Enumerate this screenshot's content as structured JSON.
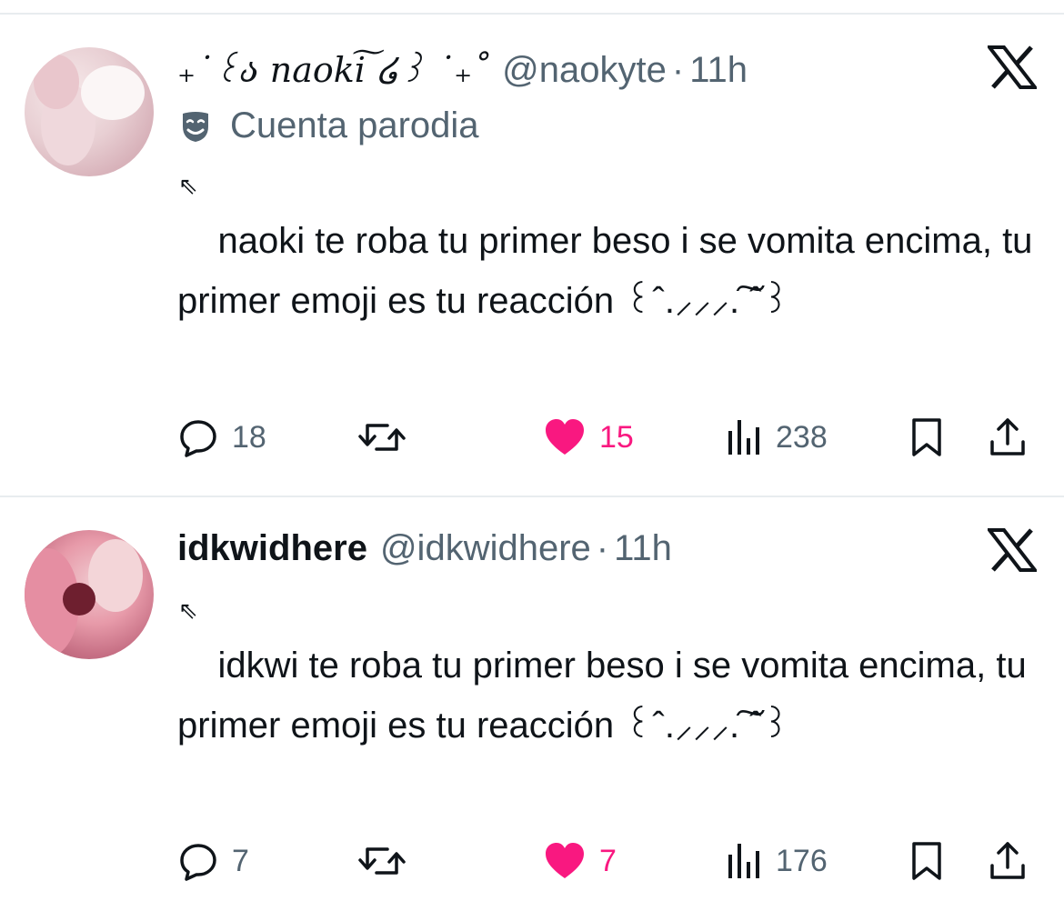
{
  "tweets": [
    {
      "avatar": "avatar-naokyte",
      "display_name": "₊˙꒰ა 𝑛𝑎𝑜𝑘𝑖͠ ໒꒱ ˙₊˚",
      "handle": "@naokyte",
      "separator": "·",
      "time": "11h",
      "parody_label": "Cuenta parodia",
      "arrow": "⇖",
      "text": "    naoki te roba tu primer beso i se vomita encima, tu primer emoji es tu reacción ꒰ˆ.⸝⸝⸝.͠ ˆ꒱",
      "replies": "18",
      "reposts": "",
      "likes": "15",
      "views": "238"
    },
    {
      "avatar": "avatar-idkwidhere",
      "display_name": "idkwidhere",
      "handle": "@idkwidhere",
      "separator": "·",
      "time": "11h",
      "arrow": "⇖",
      "text": "    idkwi te roba tu primer beso i se vomita encima, tu primer emoji es tu reacción ꒰ˆ.⸝⸝⸝.͠ ˆ꒱",
      "replies": "7",
      "reposts": "",
      "likes": "7",
      "views": "176"
    }
  ],
  "colors": {
    "text": "#0f1419",
    "muted": "#536471",
    "like": "#f91880",
    "divider": "#e8ecef"
  },
  "icons": [
    "reply-icon",
    "repost-icon",
    "like-icon",
    "views-icon",
    "bookmark-icon",
    "share-icon",
    "x-logo-icon",
    "parody-mask-icon"
  ]
}
